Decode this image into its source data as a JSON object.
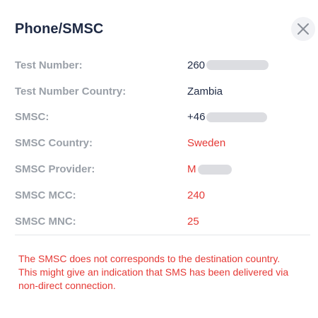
{
  "dialog": {
    "title": "Phone/SMSC",
    "close_icon": "close-icon"
  },
  "fields": [
    {
      "label": "Test Number:",
      "value": "260",
      "redacted": true,
      "status": "normal"
    },
    {
      "label": "Test Number Country:",
      "value": "Zambia",
      "redacted": false,
      "status": "normal"
    },
    {
      "label": "SMSC:",
      "value": "+46",
      "redacted": true,
      "status": "normal"
    },
    {
      "label": "SMSC Country:",
      "value": "Sweden",
      "redacted": false,
      "status": "mismatch"
    },
    {
      "label": "SMSC Provider:",
      "value": "M",
      "redacted": true,
      "status": "mismatch"
    },
    {
      "label": "SMSC MCC:",
      "value": "240",
      "redacted": false,
      "status": "mismatch"
    },
    {
      "label": "SMSC MNC:",
      "value": "25",
      "redacted": false,
      "status": "mismatch"
    }
  ],
  "warning": "The SMSC does not corresponds to the destination country. This might give an indication that SMS has been delivered via non-direct connection.",
  "colors": {
    "title": "#1f2a44",
    "label": "#9aa0a8",
    "value": "#1f2a44",
    "mismatch": "#e53935",
    "redaction": "#dcdde1"
  }
}
